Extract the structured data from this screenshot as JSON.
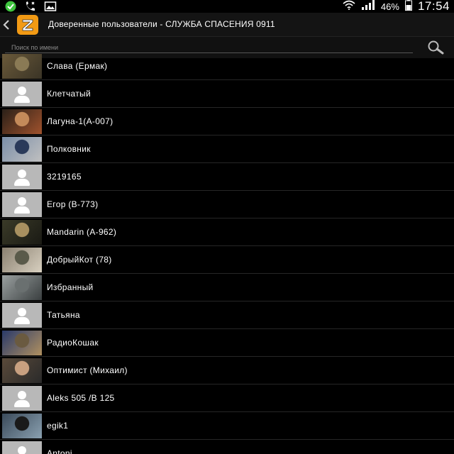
{
  "status_bar": {
    "battery_percent": "46%",
    "time": "17:54",
    "icons": [
      "check-icon",
      "phone-icon",
      "image-icon",
      "wifi-icon",
      "signal-icon",
      "battery-icon"
    ]
  },
  "header": {
    "title": "Доверенные пользователи - СЛУЖБА СПАСЕНИЯ 0911",
    "app_icon": "zello-logo-icon"
  },
  "search": {
    "placeholder": "Поиск по имени"
  },
  "contacts": [
    {
      "name": "Слава (Ермак)",
      "avatar": "photo",
      "colors": [
        "#6b5a3a",
        "#8a7a55",
        "#3a3426"
      ]
    },
    {
      "name": "Клетчатый",
      "avatar": "placeholder"
    },
    {
      "name": "Лагуна-1(А-007)",
      "avatar": "photo",
      "colors": [
        "#2a2018",
        "#c48a5a",
        "#a0522d"
      ]
    },
    {
      "name": "Полковник",
      "avatar": "photo",
      "colors": [
        "#7a8ea8",
        "#2a3a5a",
        "#c0c0c0"
      ]
    },
    {
      "name": "3219165",
      "avatar": "placeholder"
    },
    {
      "name": "Егор (В-773)",
      "avatar": "placeholder"
    },
    {
      "name": "Mandarin (А-962)",
      "avatar": "photo",
      "colors": [
        "#3a3a28",
        "#a89060",
        "#1a1a14"
      ]
    },
    {
      "name": "ДобрыйКот (78)",
      "avatar": "photo",
      "colors": [
        "#8a8070",
        "#5a5a4a",
        "#d8d0c0"
      ]
    },
    {
      "name": "Избранный",
      "avatar": "photo",
      "colors": [
        "#9aa0a0",
        "#6a7070",
        "#3a3f40"
      ]
    },
    {
      "name": "Татьяна",
      "avatar": "placeholder"
    },
    {
      "name": "РадиоКошак",
      "avatar": "photo",
      "colors": [
        "#2a3a6a",
        "#6a5a40",
        "#b09060"
      ]
    },
    {
      "name": "Оптимист (Михаил)",
      "avatar": "photo",
      "colors": [
        "#5a4a3a",
        "#c8a080",
        "#2a2a2a"
      ]
    },
    {
      "name": "Aleks 505 /B 125",
      "avatar": "placeholder"
    },
    {
      "name": "egik1",
      "avatar": "photo",
      "colors": [
        "#3a4a5a",
        "#1a1a1a",
        "#8aa0b0"
      ]
    },
    {
      "name": "Antoni",
      "avatar": "placeholder"
    }
  ]
}
